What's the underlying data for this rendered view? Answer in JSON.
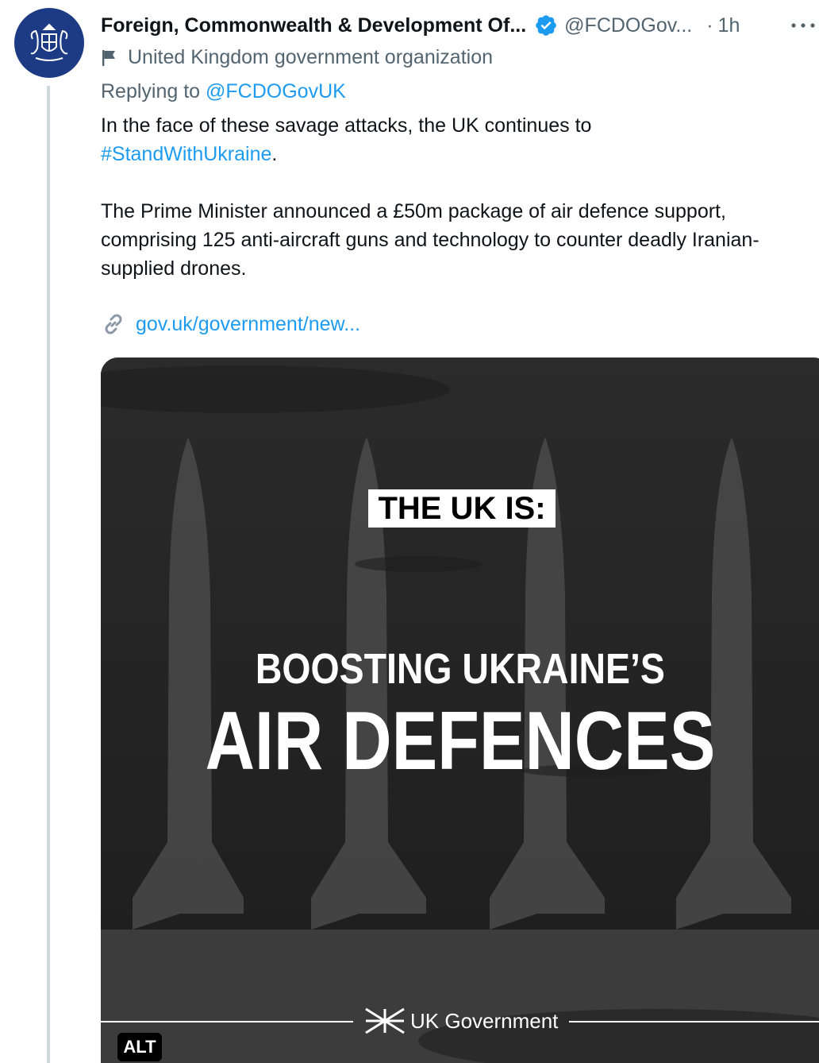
{
  "author": {
    "display_name": "Foreign, Commonwealth & Development Of...",
    "handle": "@FCDOGov...",
    "separator": "·",
    "timestamp": "1h",
    "label": "United Kingdom government organization",
    "verified_color": "#1d9bf0",
    "avatar_color": "#1d3b84"
  },
  "reply": {
    "prefix": "Replying to ",
    "target": "@FCDOGovUK"
  },
  "tweet": {
    "line1": "In the face of these savage attacks, the UK continues to",
    "hashtag": "#StandWithUkraine",
    "hashtag_suffix": ".",
    "paragraph2": "The Prime Minister announced a £50m package of air defence support, comprising 125 anti-aircraft guns and technology to counter deadly Iranian-supplied drones."
  },
  "card_link": {
    "text": "gov.uk/government/new...",
    "icon": "link-icon"
  },
  "media": {
    "kicker": "THE UK IS:",
    "headline_line1": "BOOSTING UKRAINE’S",
    "headline_line2": "AIR DEFENCES",
    "brand": "UK Government",
    "alt_badge": "ALT"
  },
  "icons": {
    "verified": "verified-badge-icon",
    "more": "more-options-icon",
    "label": "flag-icon"
  }
}
